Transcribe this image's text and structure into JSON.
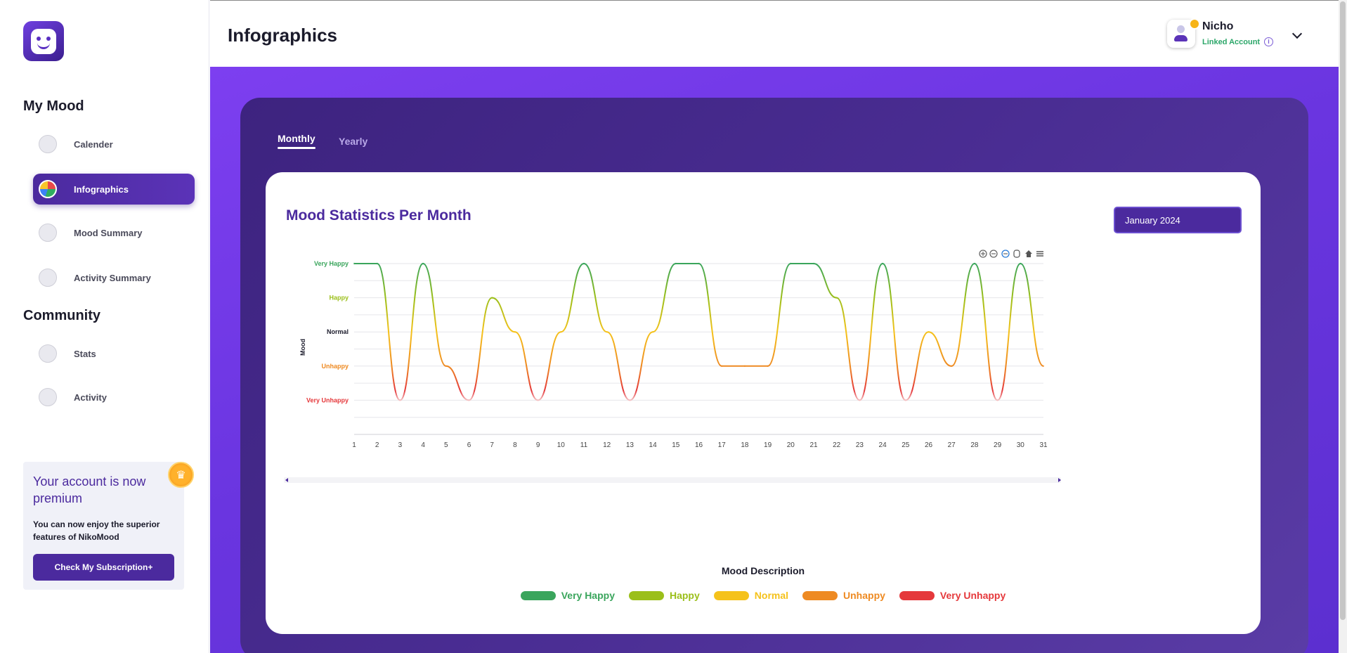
{
  "sidebar": {
    "section_my_mood": "My Mood",
    "section_community": "Community",
    "items": [
      {
        "label": "Calender",
        "icon": "calendar-icon"
      },
      {
        "label": "Infographics",
        "icon": "pie-chart-icon"
      },
      {
        "label": "Mood Summary",
        "icon": "mood-summary-icon"
      },
      {
        "label": "Activity Summary",
        "icon": "activity-summary-icon"
      },
      {
        "label": "Stats",
        "icon": "stats-icon"
      },
      {
        "label": "Activity",
        "icon": "activity-icon"
      }
    ],
    "premium": {
      "title": "Your account is now premium",
      "text": "You can now enjoy the superior features of NikoMood",
      "button": "Check My Subscription+",
      "icon": "crown-icon"
    }
  },
  "header": {
    "title": "Infographics",
    "user_name": "Nicho",
    "linked_account": "Linked Account",
    "info_glyph": "i"
  },
  "tabs": [
    {
      "label": "Monthly",
      "active": true
    },
    {
      "label": "Yearly",
      "active": false
    }
  ],
  "card": {
    "title": "Mood Statistics Per Month",
    "selected_month": "January 2024"
  },
  "colors": {
    "very_happy": "#3aa55c",
    "happy": "#9bbf1a",
    "normal": "#f5c21b",
    "unhappy": "#ee8a22",
    "very_unhappy": "#e5383b",
    "accent": "#4b2a9e"
  },
  "chart_data": {
    "type": "line",
    "ylabel": "Mood",
    "y_categories": [
      "Very Unhappy",
      "Unhappy",
      "Normal",
      "Happy",
      "Very Happy"
    ],
    "x": [
      1,
      2,
      3,
      4,
      5,
      6,
      7,
      8,
      9,
      10,
      11,
      12,
      13,
      14,
      15,
      16,
      17,
      18,
      19,
      20,
      21,
      22,
      23,
      24,
      25,
      26,
      27,
      28,
      29,
      30,
      31
    ],
    "values": [
      5,
      5,
      1,
      5,
      2,
      1,
      4,
      3,
      1,
      3,
      5,
      3,
      1,
      3,
      5,
      5,
      2,
      2,
      2,
      5,
      5,
      4,
      1,
      5,
      1,
      3,
      2,
      5,
      1,
      5,
      2
    ],
    "legend_title": "Mood Description",
    "legend": [
      "Very Happy",
      "Happy",
      "Normal",
      "Unhappy",
      "Very Unhappy"
    ],
    "grid": true
  }
}
